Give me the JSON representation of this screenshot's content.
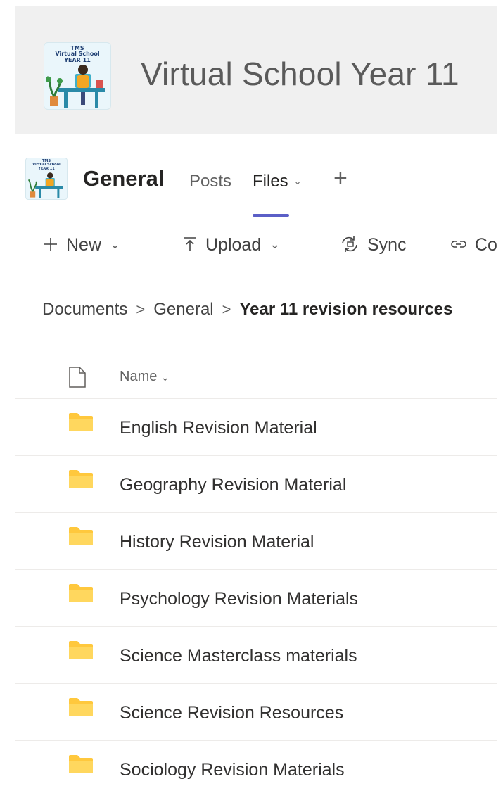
{
  "team": {
    "logo_text": "TMS\nVirtual School\nYEAR 11",
    "name": "Virtual School Year 11"
  },
  "channel": {
    "name": "General",
    "tabs": [
      {
        "label": "Posts",
        "selected": false
      },
      {
        "label": "Files",
        "selected": true
      }
    ],
    "add_tab_icon": "plus-icon"
  },
  "toolbar": {
    "new_label": "New",
    "upload_label": "Upload",
    "sync_label": "Sync",
    "copy_label": "Co"
  },
  "breadcrumb": [
    "Documents",
    "General",
    "Year 11 revision resources"
  ],
  "list": {
    "name_header": "Name",
    "folders": [
      "English Revision Material",
      "Geography Revision Material",
      "History Revision Material",
      "Psychology Revision Materials",
      "Science Masterclass materials",
      "Science Revision Resources",
      "Sociology Revision Materials"
    ]
  },
  "colors": {
    "accent": "#5b5fc7",
    "folder": "#ffd75e",
    "header_background": "#f0f0f0"
  }
}
